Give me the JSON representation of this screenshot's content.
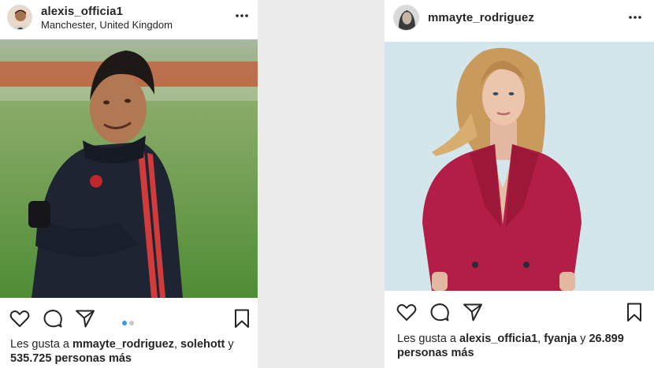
{
  "left_post": {
    "username": "alexis_officia1",
    "location": "Manchester, United Kingdom",
    "carousel": {
      "total": 2,
      "current": 1
    },
    "likes": {
      "prefix": "Les gusta a ",
      "user1": "mmayte_rodriguez",
      "sep": ", ",
      "user2": "solehott",
      "conj": " y",
      "count": "535.725",
      "suffix": " personas más"
    }
  },
  "right_post": {
    "username": "mmayte_rodriguez",
    "likes": {
      "prefix": "Les gusta a ",
      "user1": "alexis_officia1",
      "sep": ", ",
      "user2": "fyanja",
      "conj": " y ",
      "count": "26.899",
      "suffix": "personas más"
    }
  },
  "icons": [
    "more-icon",
    "heart-icon",
    "comment-icon",
    "share-icon",
    "bookmark-icon"
  ],
  "colors": {
    "accent": "#3897f0",
    "text": "#262626",
    "inactive_dot": "#c7c7c7",
    "background": "#ececec"
  }
}
